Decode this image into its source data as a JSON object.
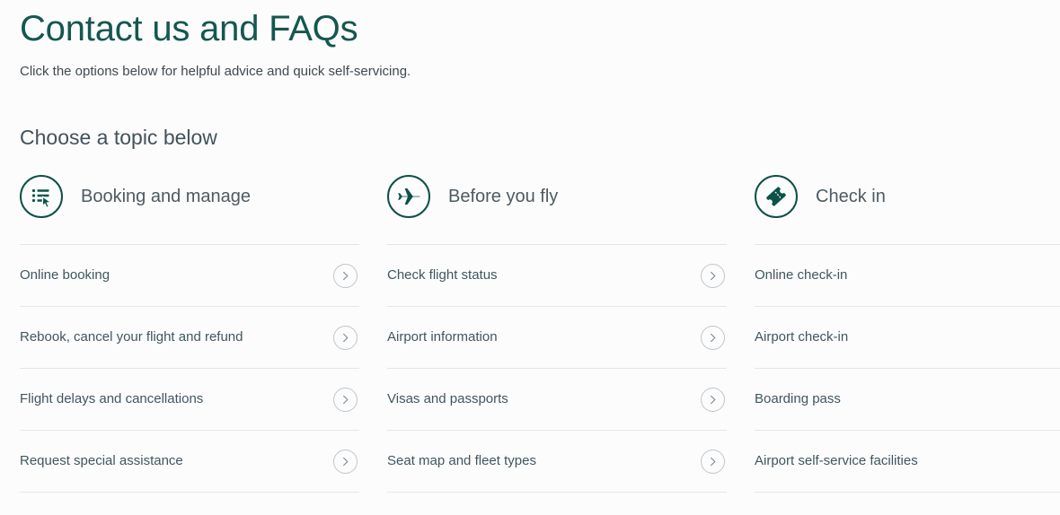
{
  "header": {
    "title": "Contact us and FAQs",
    "subtitle": "Click the options below for helpful advice and quick self-servicing.",
    "section_heading": "Choose a topic below"
  },
  "colors": {
    "title": "#15574f",
    "icon_stroke": "#0f4f47",
    "icon_fill": "#0b5349",
    "label": "#41565f",
    "divider": "#e3e6e8",
    "chevron_ring": "#bfc6ca",
    "background": "#fcfcfd"
  },
  "columns": [
    {
      "icon": "list-cursor-icon",
      "label": "Booking and manage",
      "topics": [
        {
          "label": "Online booking",
          "chevron": "chevron-right-icon"
        },
        {
          "label": "Rebook, cancel your flight and refund",
          "chevron": "chevron-right-icon"
        },
        {
          "label": "Flight delays and cancellations",
          "chevron": "chevron-right-icon"
        },
        {
          "label": "Request special assistance",
          "chevron": "chevron-right-icon"
        }
      ]
    },
    {
      "icon": "airplane-icon",
      "label": "Before you fly",
      "topics": [
        {
          "label": "Check flight status",
          "chevron": "chevron-right-icon"
        },
        {
          "label": "Airport information",
          "chevron": "chevron-right-icon"
        },
        {
          "label": "Visas and passports",
          "chevron": "chevron-right-icon"
        },
        {
          "label": "Seat map and fleet types",
          "chevron": "chevron-right-icon"
        }
      ]
    },
    {
      "icon": "boarding-pass-icon",
      "label": "Check in",
      "topics": [
        {
          "label": "Online check-in",
          "chevron": "chevron-right-icon"
        },
        {
          "label": "Airport check-in",
          "chevron": "chevron-right-icon"
        },
        {
          "label": "Boarding pass",
          "chevron": "chevron-right-icon"
        },
        {
          "label": "Airport self-service facilities",
          "chevron": "chevron-right-icon"
        }
      ]
    }
  ]
}
